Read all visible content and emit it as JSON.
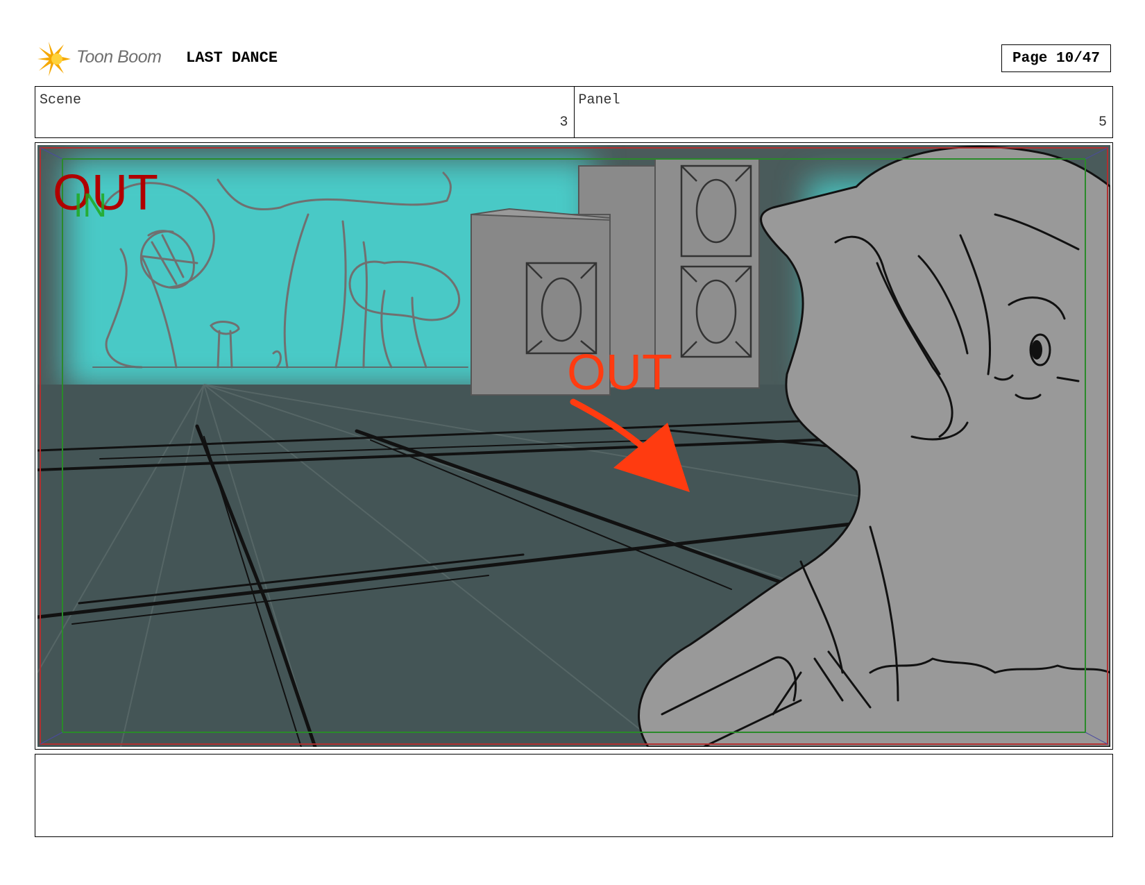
{
  "header": {
    "brand": "Toon Boom",
    "project_title": "LAST DANCE",
    "page_label": "Page 10/47"
  },
  "info": {
    "scene_label": "Scene",
    "scene_value": "3",
    "panel_label": "Panel",
    "panel_value": "5"
  },
  "panel_image": {
    "annotations": {
      "out_top": "OUT",
      "in_top": "IN",
      "out_mid": "OUT"
    },
    "colors": {
      "cyan_glow": "#48d0cc",
      "floor": "#445556",
      "wall": "#4a5b5b",
      "red_arrow": "#ff3b10",
      "gray_character": "#999999",
      "frame_red": "#b03030",
      "frame_green": "#2a8a2a"
    }
  },
  "notes": {
    "text": ""
  }
}
